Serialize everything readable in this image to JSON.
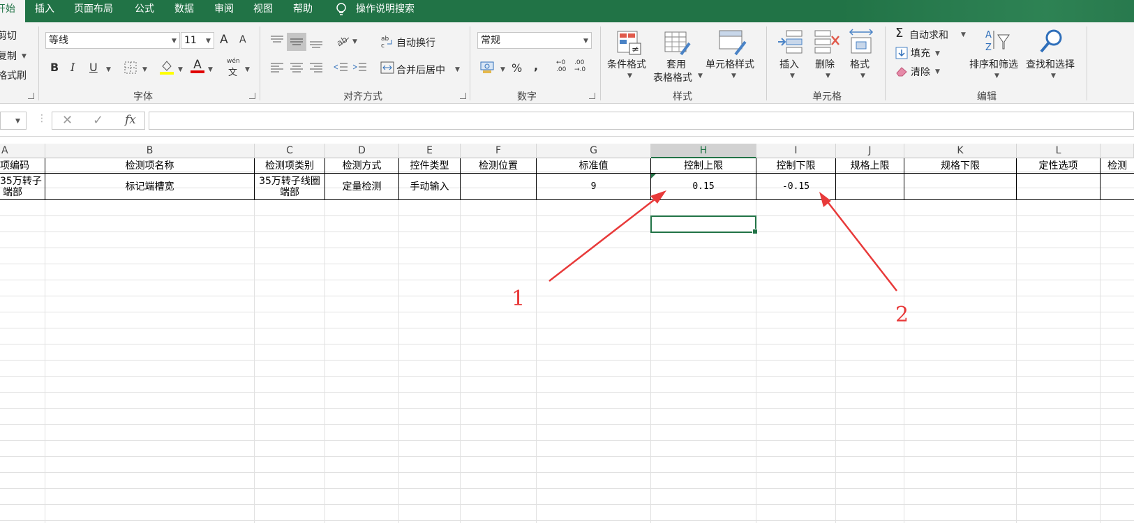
{
  "menu": {
    "tabs": [
      {
        "label": "开始",
        "active": true
      },
      {
        "label": "插入"
      },
      {
        "label": "页面布局"
      },
      {
        "label": "公式"
      },
      {
        "label": "数据"
      },
      {
        "label": "审阅"
      },
      {
        "label": "视图"
      },
      {
        "label": "帮助"
      }
    ],
    "search_icon": "lightbulb-icon",
    "search_label": "操作说明搜索"
  },
  "ribbon": {
    "clipboard": {
      "cut": "剪切",
      "copy": "复制",
      "format_painter": "格式刷"
    },
    "font": {
      "name": "等线",
      "size": "11",
      "grow": "A",
      "shrink": "A",
      "bold": "B",
      "italic": "I",
      "underline": "U",
      "font_color": "A",
      "phonetic_top": "wén",
      "phonetic": "文",
      "group_label": "字体"
    },
    "alignment": {
      "wrap_label": "自动换行",
      "merge_label": "合并后居中",
      "group_label": "对齐方式"
    },
    "number": {
      "format": "常规",
      "percent": "%",
      "comma": ",",
      "inc_top": "←0",
      "inc_bottom": ".00",
      "dec_top": ".00",
      "dec_bottom": "→.0",
      "group_label": "数字"
    },
    "styles": {
      "conditional": "条件格式",
      "table_top": "套用",
      "table_bottom": "表格格式",
      "cell_styles": "单元格样式",
      "group_label": "样式"
    },
    "cells": {
      "insert": "插入",
      "delete": "删除",
      "format": "格式",
      "group_label": "单元格"
    },
    "editing": {
      "sigma": "Σ",
      "autosum": "自动求和",
      "fill": "填充",
      "clear": "清除",
      "sort_filter": "排序和筛选",
      "find_select": "查找和选择",
      "group_label": "编辑"
    }
  },
  "formula_bar": {
    "cancel": "✕",
    "enter": "✓",
    "fx": "fx",
    "value": ""
  },
  "columns": [
    "A",
    "B",
    "C",
    "D",
    "E",
    "F",
    "G",
    "H",
    "I",
    "J",
    "K",
    "L",
    ""
  ],
  "selected_column": "H",
  "header_row": [
    "项编码",
    "检测项名称",
    "检测项类别",
    "检测方式",
    "控件类型",
    "检测位置",
    "标准值",
    "控制上限",
    "控制下限",
    "规格上限",
    "规格下限",
    "定性选项",
    "检测标"
  ],
  "data_row": {
    "a_line1": "35万转子",
    "a_line2": "端部",
    "b": "标记端槽宽",
    "c_line1": "35万转子线圈",
    "c_line2": "端部",
    "d": "定量检测",
    "e": "手动输入",
    "f": "",
    "g": "9",
    "h": "0.15",
    "i": "-0.15",
    "j": "",
    "k": "",
    "l": "",
    "m": ""
  },
  "annotations": {
    "label1": "1",
    "label2": "2",
    "color": "#e83a3a"
  },
  "colors": {
    "brand": "#217346",
    "ribbon_bg": "#f3f3f3"
  }
}
